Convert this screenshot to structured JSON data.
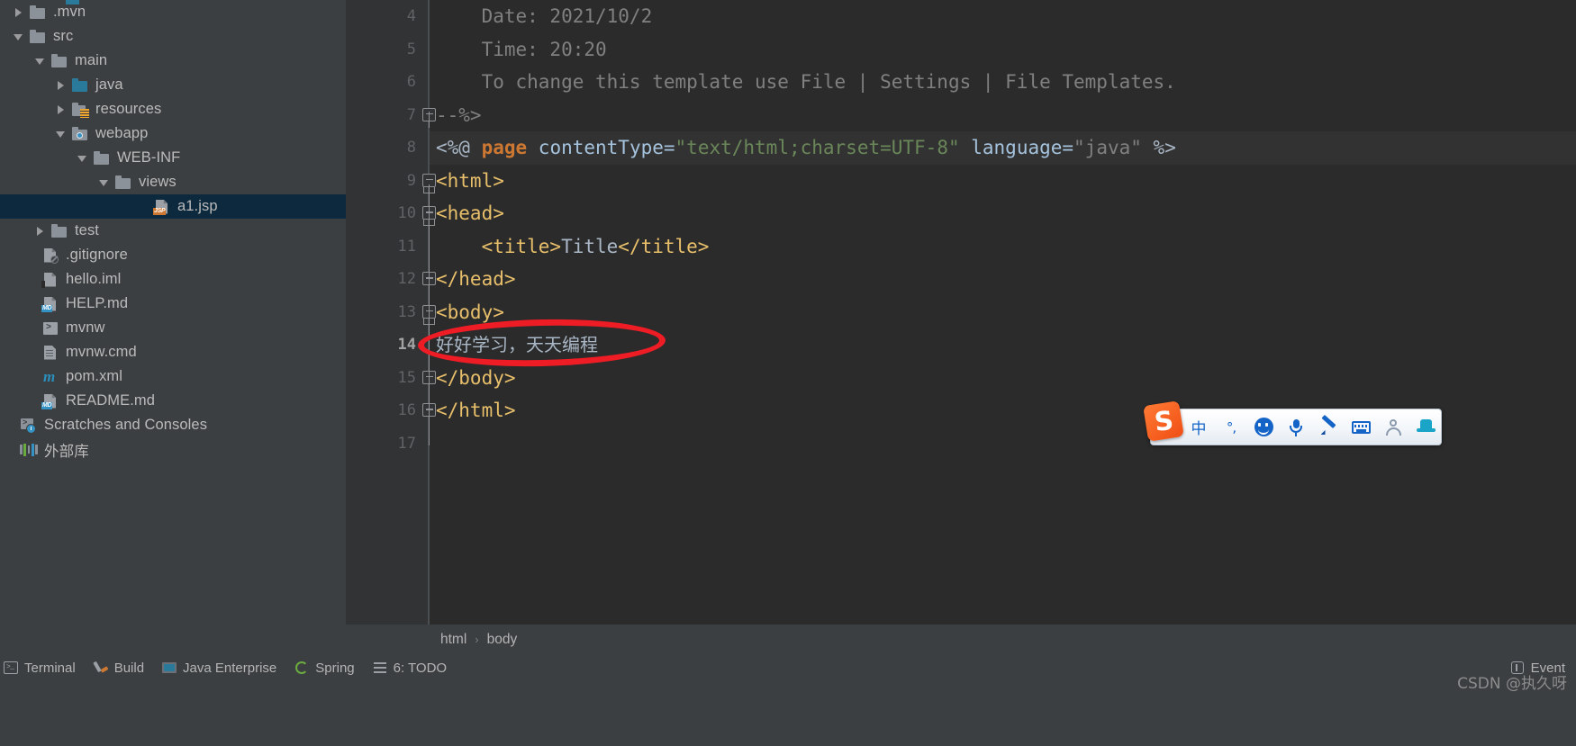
{
  "sidebar": {
    "name": "project-tree",
    "items": [
      {
        "label": ".mvn",
        "indent": 14,
        "arrow": "right",
        "icon": "folder",
        "selected": false
      },
      {
        "label": "src",
        "indent": 14,
        "arrow": "down",
        "icon": "folder",
        "selected": false
      },
      {
        "label": "main",
        "indent": 38,
        "arrow": "down",
        "icon": "folder",
        "selected": false
      },
      {
        "label": "java",
        "indent": 61,
        "arrow": "right",
        "icon": "folder-blue",
        "selected": false
      },
      {
        "label": "resources",
        "indent": 61,
        "arrow": "right",
        "icon": "folder-res",
        "selected": false
      },
      {
        "label": "webapp",
        "indent": 61,
        "arrow": "down",
        "icon": "folder-web",
        "selected": false
      },
      {
        "label": "WEB-INF",
        "indent": 85,
        "arrow": "down",
        "icon": "folder",
        "selected": false
      },
      {
        "label": "views",
        "indent": 109,
        "arrow": "down",
        "icon": "folder",
        "selected": false
      },
      {
        "label": "a1.jsp",
        "indent": 152,
        "arrow": "none",
        "icon": "file-jsp",
        "selected": true
      },
      {
        "label": "test",
        "indent": 38,
        "arrow": "right",
        "icon": "folder",
        "selected": false
      },
      {
        "label": ".gitignore",
        "indent": 28,
        "arrow": "none",
        "icon": "gitignore",
        "selected": false
      },
      {
        "label": "hello.iml",
        "indent": 28,
        "arrow": "none",
        "icon": "file-iml",
        "selected": false
      },
      {
        "label": "HELP.md",
        "indent": 28,
        "arrow": "none",
        "icon": "file-md",
        "selected": false
      },
      {
        "label": "mvnw",
        "indent": 28,
        "arrow": "none",
        "icon": "shell",
        "selected": false
      },
      {
        "label": "mvnw.cmd",
        "indent": 28,
        "arrow": "none",
        "icon": "lined",
        "selected": false
      },
      {
        "label": "pom.xml",
        "indent": 28,
        "arrow": "none",
        "icon": "maven",
        "selected": false
      },
      {
        "label": "README.md",
        "indent": 28,
        "arrow": "none",
        "icon": "file-md",
        "selected": false
      },
      {
        "label": "Scratches and Consoles",
        "indent": 4,
        "arrow": "none",
        "icon": "scratch",
        "selected": false
      },
      {
        "label": "外部库",
        "indent": 4,
        "arrow": "none",
        "icon": "libs",
        "selected": false
      }
    ]
  },
  "editor": {
    "name": "jsp-code-editor",
    "current_line": 14,
    "lines": [
      {
        "no": "4",
        "fold": "none",
        "tokens": [
          {
            "t": "    Date: 2021/10/2",
            "c": "t-comment"
          }
        ]
      },
      {
        "no": "5",
        "fold": "none",
        "tokens": [
          {
            "t": "    Time: 20:20",
            "c": "t-comment"
          }
        ]
      },
      {
        "no": "6",
        "fold": "none",
        "tokens": [
          {
            "t": "    To change this template use File | Settings | File Templates.",
            "c": "t-comment"
          }
        ]
      },
      {
        "no": "7",
        "fold": "end",
        "tokens": [
          {
            "t": "--%>",
            "c": "t-comment"
          }
        ]
      },
      {
        "no": "8",
        "fold": "none",
        "highlight": true,
        "tokens": [
          {
            "t": "<%@ ",
            "c": "t-punct"
          },
          {
            "t": "page",
            "c": "t-kw"
          },
          {
            "t": " contentType=",
            "c": "t-attrn"
          },
          {
            "t": "\"text/html;charset=UTF-8\"",
            "c": "t-str"
          },
          {
            "t": " language=",
            "c": "t-attrn"
          },
          {
            "t": "\"java\"",
            "c": "t-comment"
          },
          {
            "t": " %>",
            "c": "t-punct"
          }
        ]
      },
      {
        "no": "9",
        "fold": "start",
        "tokens": [
          {
            "t": "<html>",
            "c": "t-tag"
          }
        ]
      },
      {
        "no": "10",
        "fold": "start",
        "tokens": [
          {
            "t": "<head>",
            "c": "t-tag"
          }
        ]
      },
      {
        "no": "11",
        "fold": "none",
        "tokens": [
          {
            "t": "    <title>",
            "c": "t-tag"
          },
          {
            "t": "Title",
            "c": "t-title"
          },
          {
            "t": "</title>",
            "c": "t-tag"
          }
        ]
      },
      {
        "no": "12",
        "fold": "end",
        "tokens": [
          {
            "t": "</head>",
            "c": "t-tag"
          }
        ]
      },
      {
        "no": "13",
        "fold": "start",
        "tokens": [
          {
            "t": "<body>",
            "c": "t-tag"
          }
        ]
      },
      {
        "no": "14",
        "fold": "none",
        "cjk": true,
        "tokens": [
          {
            "t": "好好学习，天天编程",
            "c": "t-txt"
          }
        ]
      },
      {
        "no": "15",
        "fold": "end",
        "tokens": [
          {
            "t": "</body>",
            "c": "t-tag"
          }
        ]
      },
      {
        "no": "16",
        "fold": "end",
        "tokens": [
          {
            "t": "</html>",
            "c": "t-tag"
          }
        ]
      },
      {
        "no": "17",
        "fold": "none",
        "tokens": [
          {
            "t": "",
            "c": "t-plain"
          }
        ]
      }
    ]
  },
  "annotation": {
    "name": "red-circle-highlight",
    "target_text": "好好学习，天天编程",
    "color": "#ee1c25"
  },
  "breadcrumb": {
    "name": "editor-breadcrumb",
    "items": [
      "html",
      "body"
    ],
    "separator": "›"
  },
  "tool_windows": {
    "name": "tool-window-bar",
    "items": [
      {
        "label": "Terminal",
        "icon": "terminal-icon"
      },
      {
        "label": "Build",
        "icon": "build-icon"
      },
      {
        "label": "Java Enterprise",
        "icon": "java-enterprise-icon"
      },
      {
        "label": "Spring",
        "icon": "spring-icon"
      },
      {
        "label": "6: TODO",
        "icon": "todo-icon"
      },
      {
        "label": "Event",
        "icon": "event-icon"
      }
    ]
  },
  "ime": {
    "name": "sogou-input-method-toolbar",
    "logo_letter": "S",
    "items": [
      {
        "label": "中",
        "icon": "chinese-mode-icon",
        "type": "text"
      },
      {
        "label": "°,",
        "icon": "punctuation-mode-icon",
        "type": "text"
      },
      {
        "label": "",
        "icon": "emoji-icon",
        "type": "glyph"
      },
      {
        "label": "",
        "icon": "voice-input-icon",
        "type": "glyph"
      },
      {
        "label": "",
        "icon": "handwriting-pen-icon",
        "type": "glyph"
      },
      {
        "label": "",
        "icon": "soft-keyboard-icon",
        "type": "glyph"
      },
      {
        "label": "",
        "icon": "user-account-icon",
        "type": "glyph"
      },
      {
        "label": "",
        "icon": "skin-hat-icon",
        "type": "glyph"
      }
    ]
  },
  "watermark": {
    "name": "csdn-watermark",
    "text": "CSDN @执久呀"
  },
  "colors": {
    "sidebar_bg": "#3c3f41",
    "editor_bg": "#2b2b2b",
    "gutter_bg": "#313335",
    "selection_bg": "#0d293e",
    "tag_color": "#e8bf6a",
    "string_color": "#6a8759",
    "keyword_color": "#cc7832",
    "comment_color": "#808080",
    "annotation_red": "#ee1c25",
    "ime_blue": "#1464c8",
    "sogou_orange": "#f04e14"
  }
}
